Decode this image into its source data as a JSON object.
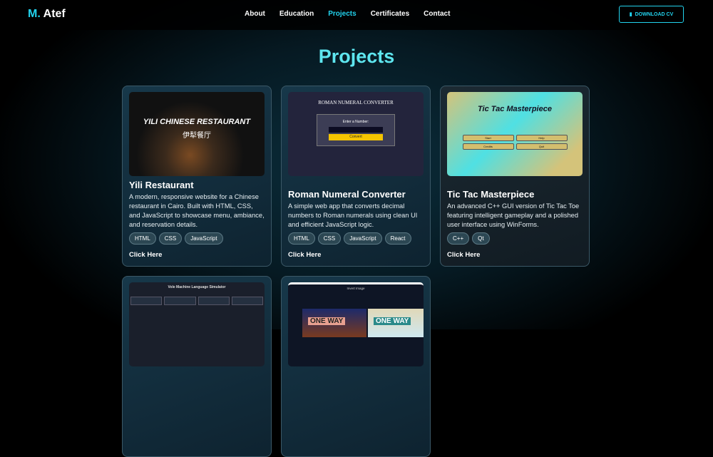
{
  "nav": {
    "logo_first": "M.",
    "logo_last": "Atef",
    "links": [
      "About",
      "Education",
      "Projects",
      "Certificates",
      "Contact"
    ],
    "active": "Projects",
    "download": "DOWNLOAD CV"
  },
  "section_title": "Projects",
  "projects": [
    {
      "title": "Yili Restaurant",
      "description": "A modern, responsive website for a Chinese restaurant in Cairo. Built with HTML, CSS, and JavaScript to showcase menu, ambiance, and reservation details.",
      "tags": [
        "HTML",
        "CSS",
        "JavaScript"
      ],
      "link": "Click Here",
      "shot_title": "YILI CHINESE RESTAURANT",
      "shot_subtitle": "伊犁餐厅"
    },
    {
      "title": "Roman Numeral Converter",
      "description": "A simple web app that converts decimal numbers to Roman numerals using clean UI and efficient JavaScript logic.",
      "tags": [
        "HTML",
        "CSS",
        "JavaScript",
        "React"
      ],
      "link": "Click Here",
      "shot_title": "ROMAN NUMERAL CONVERTER",
      "shot_label": "Enter a Number:",
      "shot_button": "Convert"
    },
    {
      "title": "Tic Tac Masterpiece",
      "description": "An advanced C++ GUI version of Tic Tac Toe featuring intelligent gameplay and a polished user interface using WinForms.",
      "tags": [
        "C++",
        "Qt"
      ],
      "link": "Click Here",
      "shot_title": "Tic Tac Masterpiece",
      "shot_buttons": [
        "Start",
        "Help",
        "Credits",
        "Quit"
      ]
    },
    {
      "shot_title": "Vole Machine Language Simulator"
    },
    {
      "shot_title": "Invert Image",
      "shot_sign": "ONE WAY"
    }
  ]
}
